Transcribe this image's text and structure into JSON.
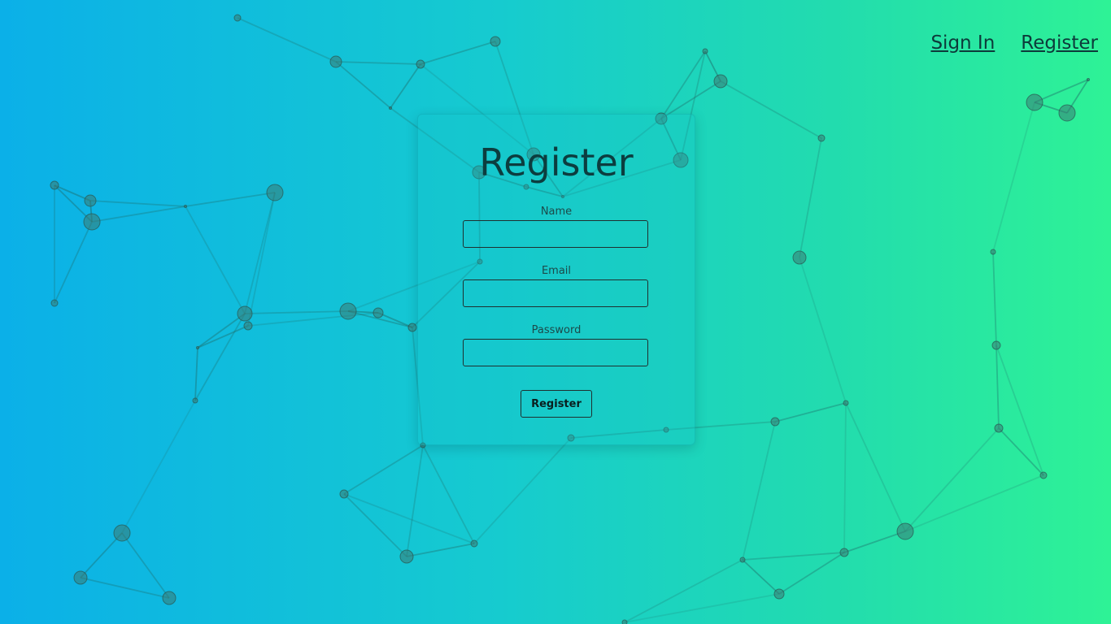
{
  "nav": {
    "sign_in": "Sign In",
    "register": "Register"
  },
  "form": {
    "title": "Register",
    "name_label": "Name",
    "email_label": "Email",
    "password_label": "Password",
    "submit_label": "Register"
  },
  "colors": {
    "gradient_start": "#0bb0e8",
    "gradient_end": "#2ef296",
    "node_fill": "#3a7a72",
    "line_color": "#1f6a66"
  }
}
